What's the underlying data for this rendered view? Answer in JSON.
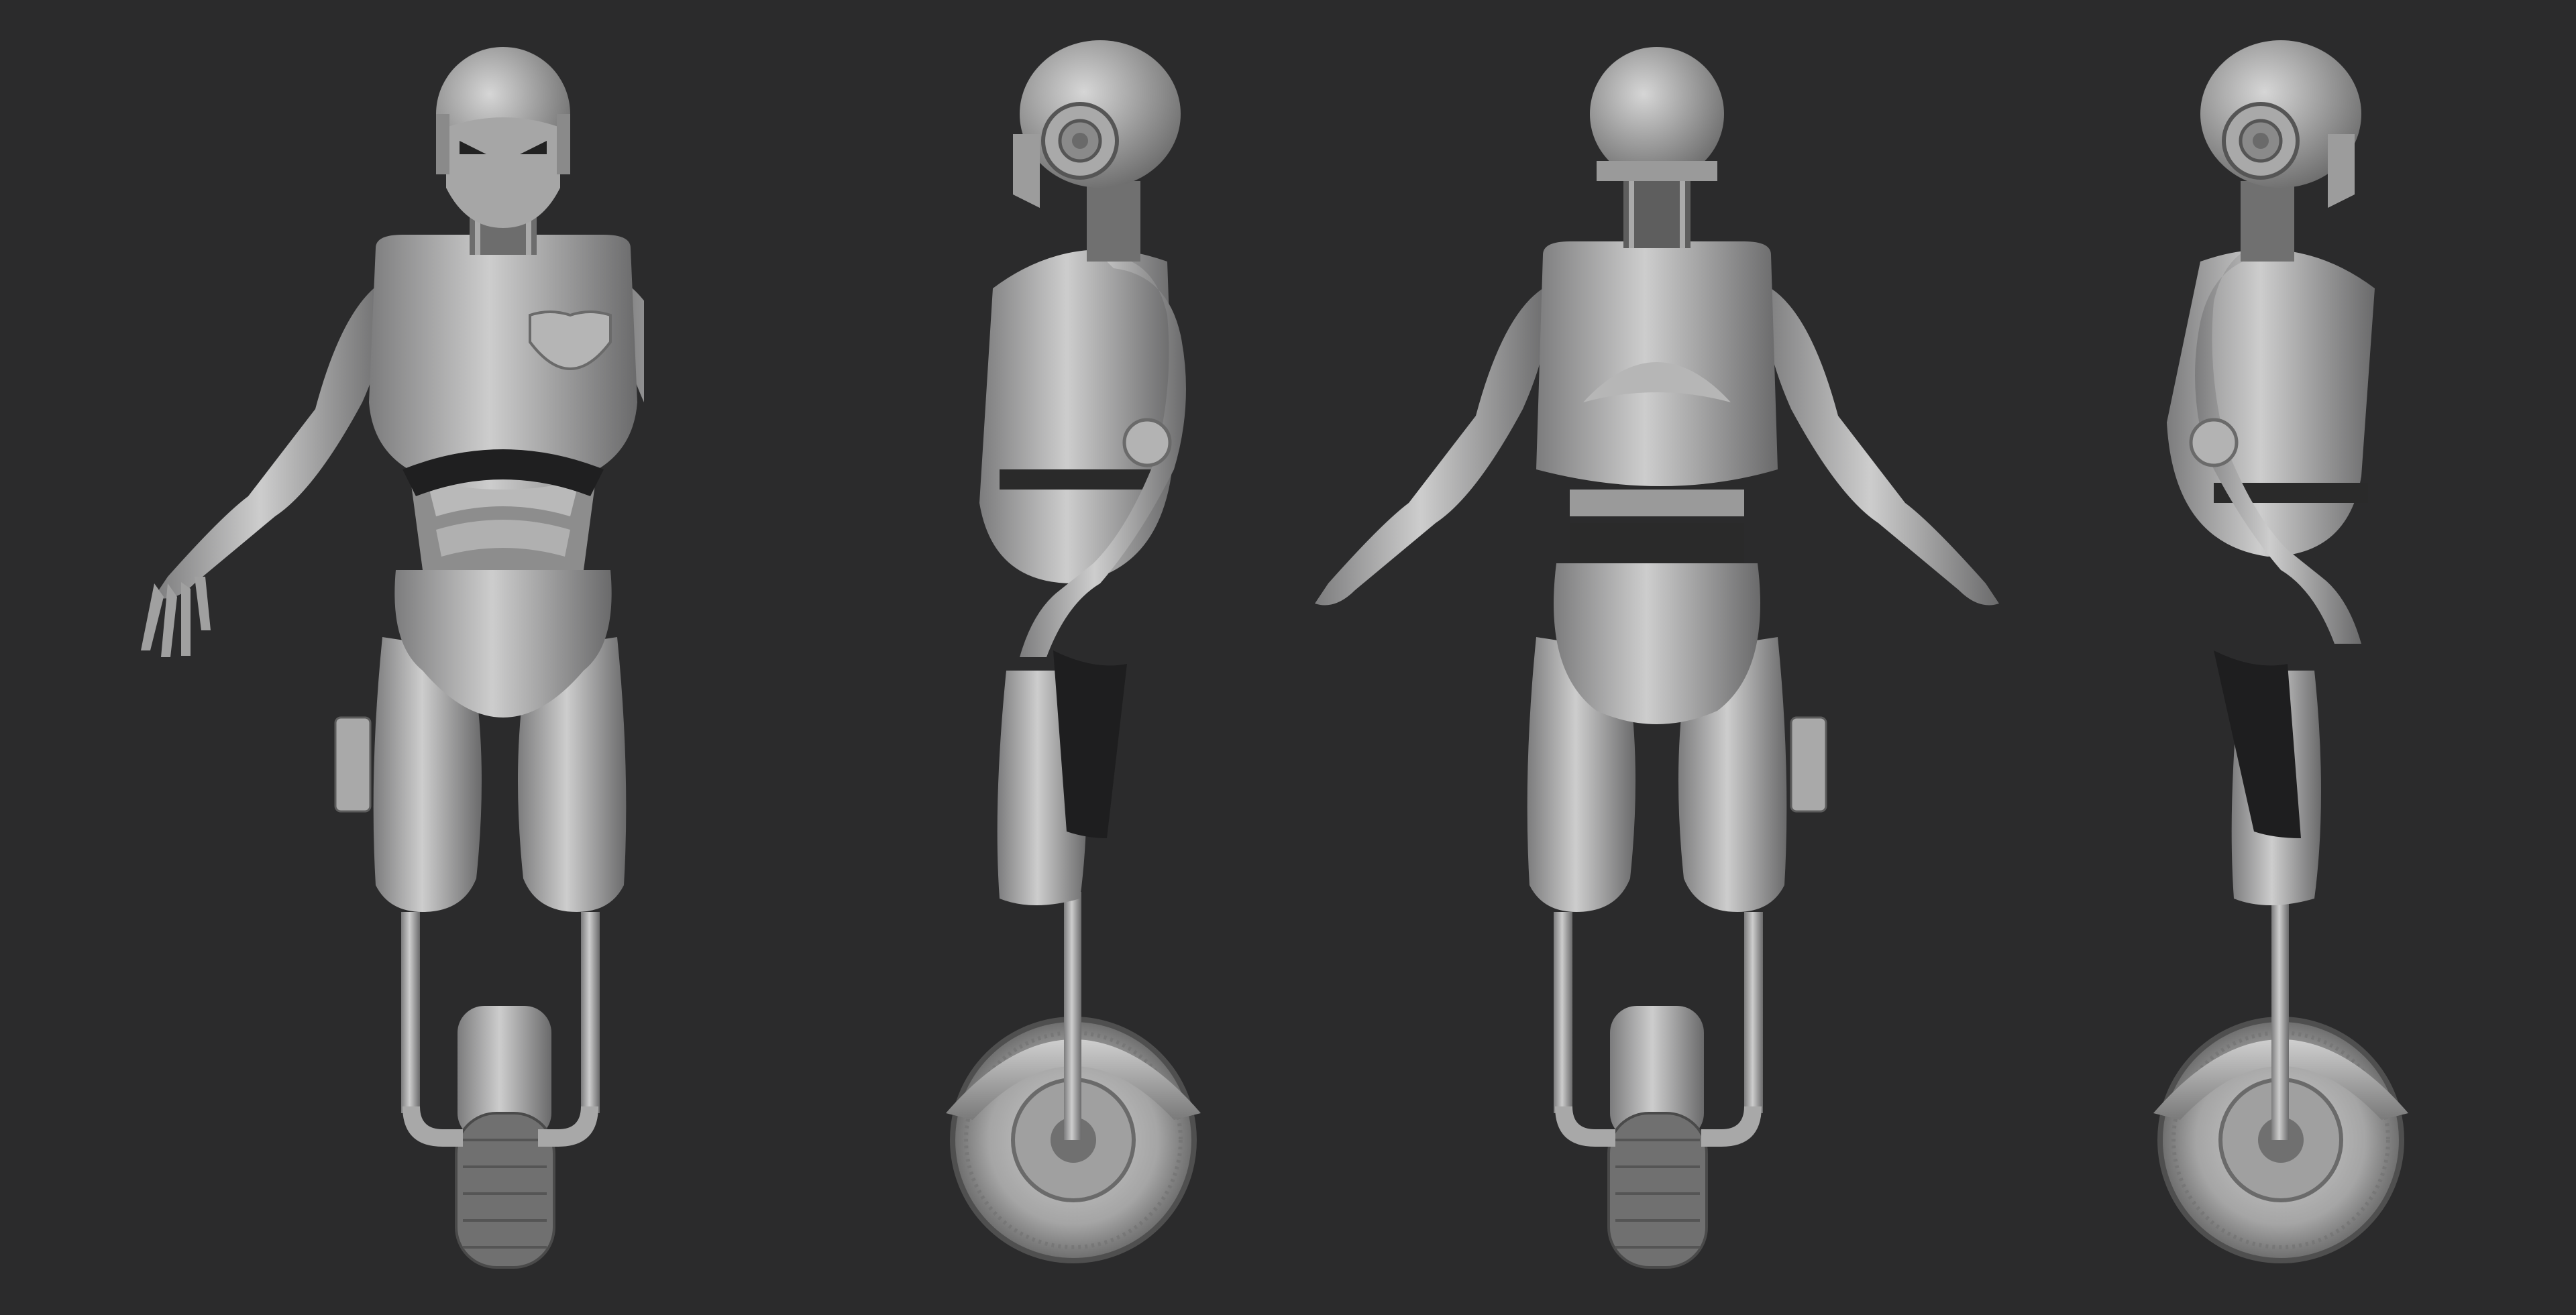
{
  "canvas": {
    "background": "#2b2b2c"
  },
  "palette": {
    "body_light": "#c7c7c7",
    "body_mid": "#9c9c9c",
    "body_dark": "#5f5f60",
    "shadow": "#1c1c1d",
    "tire": "#6e6e6e"
  },
  "views": [
    {
      "id": "front",
      "icon": "robot-front-view-icon"
    },
    {
      "id": "left-side",
      "icon": "robot-side-view-icon"
    },
    {
      "id": "back",
      "icon": "robot-back-view-icon"
    },
    {
      "id": "right-side",
      "icon": "robot-side-view-icon"
    }
  ]
}
